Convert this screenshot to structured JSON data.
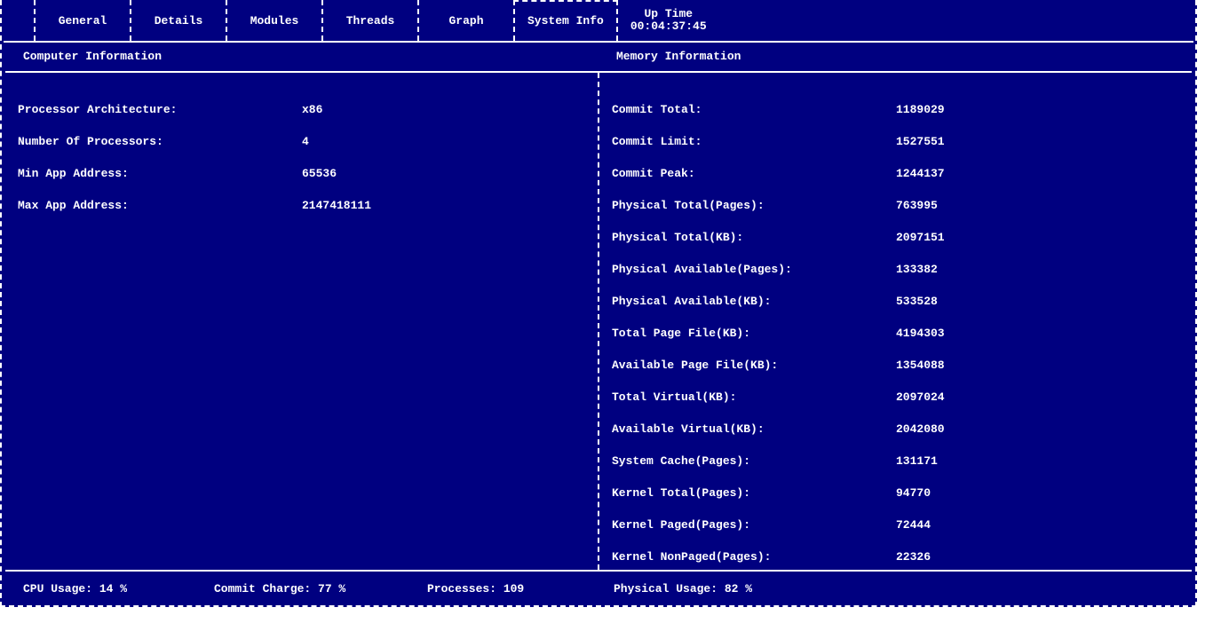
{
  "tabs": {
    "general": "General",
    "details": "Details",
    "modules": "Modules",
    "threads": "Threads",
    "graph": "Graph",
    "system_info": "System Info",
    "uptime_label": "Up Time",
    "uptime_value": "00:04:37:45"
  },
  "sections": {
    "computer": "Computer Information",
    "memory": "Memory Information"
  },
  "computer": {
    "arch_label": "Processor Architecture:",
    "arch_value": "x86",
    "nproc_label": "Number Of Processors:",
    "nproc_value": "4",
    "minaddr_label": "Min App Address:",
    "minaddr_value": "65536",
    "maxaddr_label": "Max App Address:",
    "maxaddr_value": "2147418111"
  },
  "memory": {
    "commit_total_label": "Commit Total:",
    "commit_total_value": "1189029",
    "commit_limit_label": "Commit Limit:",
    "commit_limit_value": "1527551",
    "commit_peak_label": "Commit Peak:",
    "commit_peak_value": "1244137",
    "phys_total_pages_label": "Physical Total(Pages):",
    "phys_total_pages_value": "763995",
    "phys_total_kb_label": "Physical Total(KB):",
    "phys_total_kb_value": "2097151",
    "phys_avail_pages_label": "Physical Available(Pages):",
    "phys_avail_pages_value": "133382",
    "phys_avail_kb_label": "Physical Available(KB):",
    "phys_avail_kb_value": "533528",
    "total_pagefile_label": "Total Page File(KB):",
    "total_pagefile_value": "4194303",
    "avail_pagefile_label": "Available Page File(KB):",
    "avail_pagefile_value": "1354088",
    "total_virtual_label": "Total Virtual(KB):",
    "total_virtual_value": "2097024",
    "avail_virtual_label": "Available Virtual(KB):",
    "avail_virtual_value": "2042080",
    "system_cache_label": "System Cache(Pages):",
    "system_cache_value": "131171",
    "kernel_total_label": "Kernel Total(Pages):",
    "kernel_total_value": "94770",
    "kernel_paged_label": "Kernel Paged(Pages):",
    "kernel_paged_value": "72444",
    "kernel_nonpaged_label": "Kernel NonPaged(Pages):",
    "kernel_nonpaged_value": "22326"
  },
  "status": {
    "cpu": "CPU Usage: 14 %",
    "commit": "Commit Charge: 77 %",
    "processes": "Processes: 109",
    "physical": "Physical Usage: 82 %"
  }
}
